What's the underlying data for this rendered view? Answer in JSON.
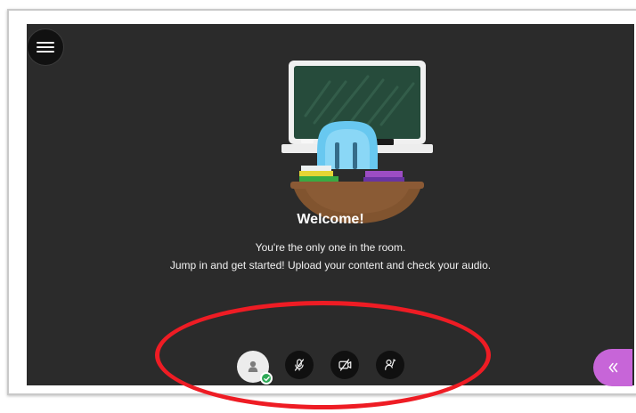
{
  "room": {
    "welcome_title": "Welcome!",
    "line_1": "You're the only one in the room.",
    "line_2": "Jump in and get started! Upload your content and check your audio."
  },
  "controls": {
    "items": [
      {
        "name": "avatar",
        "icon": "user-avatar-icon",
        "status": "connected"
      },
      {
        "name": "microphone",
        "icon": "microphone-off-icon"
      },
      {
        "name": "camera",
        "icon": "camera-off-icon"
      },
      {
        "name": "raise-hand",
        "icon": "raise-hand-icon"
      }
    ]
  },
  "icons": {
    "menu": "hamburger-menu-icon",
    "collapse_panel": "double-chevron-left-icon"
  },
  "colors": {
    "room_background": "#2b2b2b",
    "control_background": "#101010",
    "status_green": "#2eaa57",
    "panel_tab": "#c765d8",
    "highlight_red": "#ee1c24"
  }
}
